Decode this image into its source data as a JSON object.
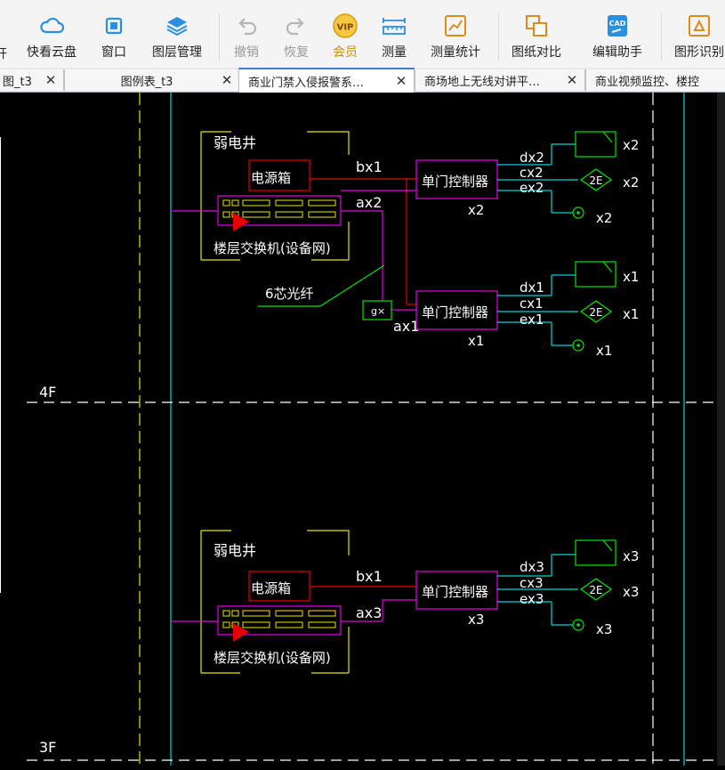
{
  "toolbar": {
    "partial_left": "开",
    "buttons": [
      {
        "label": "快看云盘",
        "icon": "cloud-icon"
      },
      {
        "label": "窗口",
        "icon": "window-icon"
      },
      {
        "label": "图层管理",
        "icon": "layers-icon"
      },
      {
        "label": "撤销",
        "icon": "undo-icon",
        "disabled": true
      },
      {
        "label": "恢复",
        "icon": "redo-icon",
        "disabled": true
      },
      {
        "label": "会员",
        "icon": "vip-icon"
      },
      {
        "label": "测量",
        "icon": "ruler-icon"
      },
      {
        "label": "测量统计",
        "icon": "measure-stats-icon"
      },
      {
        "label": "图纸对比",
        "icon": "compare-icon"
      },
      {
        "label": "编辑助手",
        "icon": "cad-edit-icon"
      },
      {
        "label": "图形识别",
        "icon": "shape-recognize-icon"
      }
    ]
  },
  "tabs": [
    {
      "label": "图_t3"
    },
    {
      "label": "图例表_t3"
    },
    {
      "label": "商业门禁入侵报警系…",
      "active": true
    },
    {
      "label": "商场地上无线对讲平…"
    },
    {
      "label": "商业视频监控、楼控"
    }
  ],
  "drawing": {
    "colors": {
      "cyan": "#00d7d7",
      "yellow": "#e6e600",
      "red": "#e60000",
      "magenta": "#e600e6",
      "green": "#00e600",
      "white": "#ffffff",
      "accent": "#3a7bd5"
    },
    "floor_labels": [
      "4F",
      "3F"
    ],
    "upper": {
      "shaft_label": "弱电井",
      "power_box": "电源箱",
      "switch_label": "楼层交换机(设备网)",
      "line_bx": "bx1",
      "line_ax": "ax2",
      "fiber_label": "6芯光纤",
      "gx_label": "g×",
      "ax1_label": "ax1",
      "controllers": [
        {
          "label": "单门控制器",
          "id": "x2",
          "lines": [
            "dx2",
            "cx2",
            "ex2"
          ],
          "tag": "x2",
          "symbol_2e": "2E"
        },
        {
          "label": "单门控制器",
          "id": "x1",
          "lines": [
            "dx1",
            "cx1",
            "ex1"
          ],
          "tag": "x1",
          "symbol_2e": "2E"
        }
      ]
    },
    "lower": {
      "shaft_label": "弱电井",
      "power_box": "电源箱",
      "switch_label": "楼层交换机(设备网)",
      "line_bx": "bx1",
      "line_ax": "ax3",
      "controller": {
        "label": "单门控制器",
        "id": "x3",
        "lines": [
          "dx3",
          "cx3",
          "ex3"
        ],
        "tag": "x3",
        "symbol_2e": "2E"
      }
    }
  }
}
